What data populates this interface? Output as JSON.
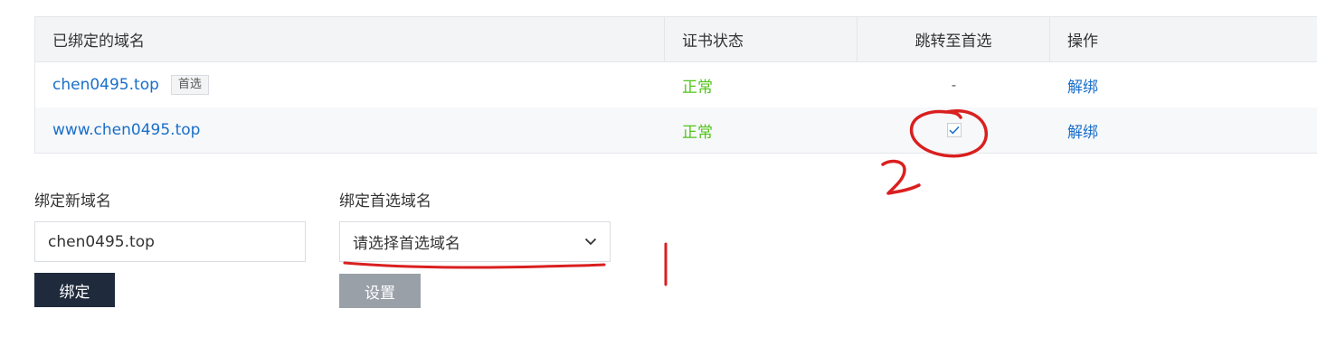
{
  "table": {
    "headers": {
      "domain": "已绑定的域名",
      "status": "证书状态",
      "redirect": "跳转至首选",
      "action": "操作"
    },
    "rows": [
      {
        "domain": "chen0495.top",
        "badge": "首选",
        "status": "正常",
        "redirect": "-",
        "action": "解绑"
      },
      {
        "domain": "www.chen0495.top",
        "status": "正常",
        "redirect_checked": true,
        "action": "解绑"
      }
    ]
  },
  "bind_form": {
    "label": "绑定新域名",
    "input_value": "chen0495.top",
    "button_label": "绑定"
  },
  "preferred_form": {
    "label": "绑定首选域名",
    "select_placeholder": "请选择首选域名",
    "button_label": "设置"
  },
  "annotations": {
    "mark_1": "1",
    "mark_2": "2",
    "color": "#d9201f"
  },
  "colors": {
    "link": "#1a6fc9",
    "status_ok": "#52c41a",
    "primary_button": "#1f2a3c",
    "disabled_button": "#9aa0a8"
  },
  "icons": {
    "checkmark": "check-icon",
    "dropdown": "chevron-down-icon"
  }
}
